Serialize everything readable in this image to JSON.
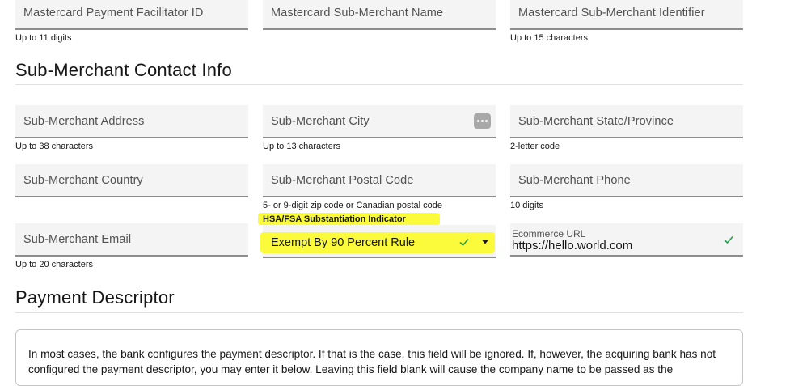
{
  "top_row": {
    "field1": {
      "placeholder": "Mastercard Payment Facilitator ID",
      "helper": "Up to 11 digits"
    },
    "field2": {
      "placeholder": "Mastercard Sub-Merchant Name"
    },
    "field3": {
      "placeholder": "Mastercard Sub-Merchant Identifier",
      "helper": "Up to 15 characters"
    }
  },
  "contact": {
    "title": "Sub-Merchant Contact Info",
    "address": {
      "placeholder": "Sub-Merchant Address",
      "helper": "Up to 38 characters"
    },
    "city": {
      "placeholder": "Sub-Merchant City",
      "helper": "Up to 13 characters"
    },
    "state": {
      "placeholder": "Sub-Merchant State/Province",
      "helper": "2-letter code"
    },
    "country": {
      "placeholder": "Sub-Merchant Country"
    },
    "postal": {
      "placeholder": "Sub-Merchant Postal Code",
      "helper": "5- or 9-digit zip code or Canadian postal code"
    },
    "phone": {
      "placeholder": "Sub-Merchant Phone",
      "helper": "10 digits"
    },
    "email": {
      "placeholder": "Sub-Merchant Email",
      "helper": "Up to 20 characters"
    },
    "hsa": {
      "label": "HSA/FSA Substantiation Indicator",
      "value": "Exempt By 90 Percent Rule"
    },
    "ecommerce": {
      "label": "Ecommerce URL",
      "value": "https://hello.world.com"
    }
  },
  "descriptor": {
    "title": "Payment Descriptor",
    "text": "In most cases, the bank configures the payment descriptor. If that is the case, this field will be ignored. If, however, the acquiring bank has not configured the payment descriptor, you may enter it below. Leaving this field blank will cause the company name to be passed as the"
  },
  "colors": {
    "highlight": "#fbfb3c",
    "check": "#24a148",
    "field_bg": "#f4f4f4"
  },
  "icons": {
    "valid": "checkmark-icon",
    "dropdown": "caret-down-icon",
    "more": "more-dots-icon"
  }
}
